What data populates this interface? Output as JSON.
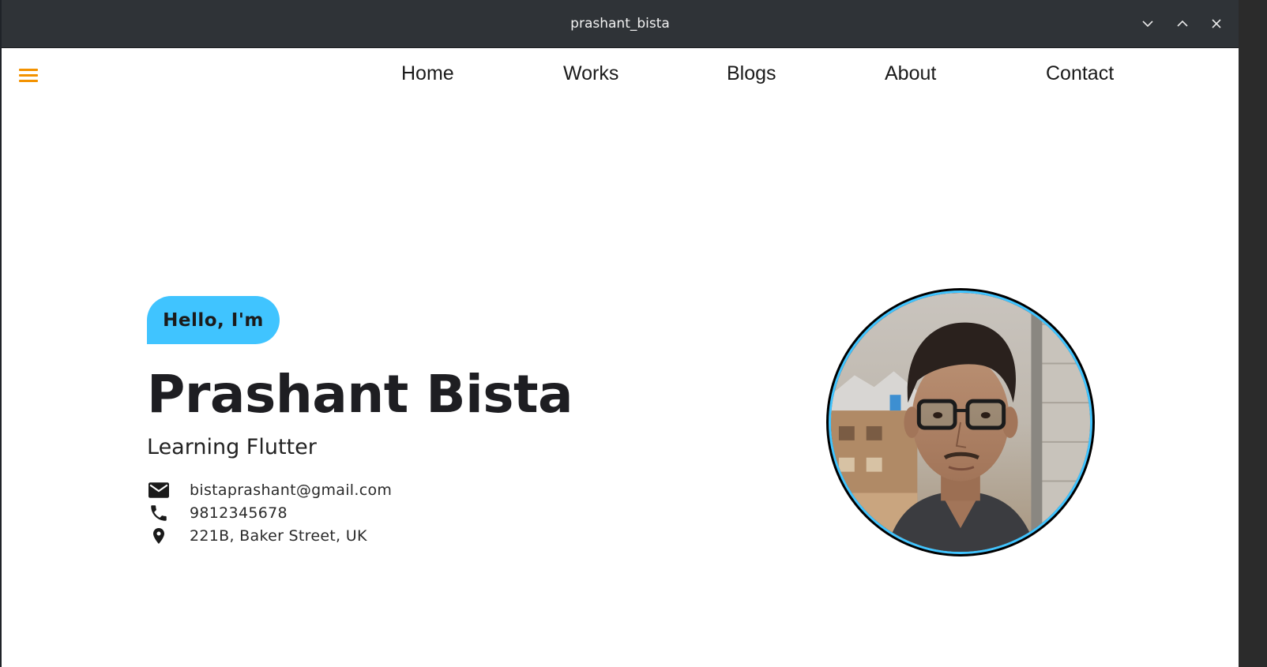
{
  "window": {
    "title": "prashant_bista",
    "controls": {
      "minimize_icon": "chevron-down-icon",
      "maximize_icon": "chevron-up-icon",
      "close_icon": "close-icon"
    }
  },
  "nav": {
    "menu_icon": "hamburger-menu-icon",
    "items": [
      "Home",
      "Works",
      "Blogs",
      "About",
      "Contact"
    ]
  },
  "hero": {
    "greeting": "Hello, I'm",
    "name": "Prashant Bista",
    "subtitle": "Learning Flutter",
    "contacts": [
      {
        "icon": "mail-icon",
        "text": "bistaprashant@gmail.com"
      },
      {
        "icon": "phone-icon",
        "text": "9812345678"
      },
      {
        "icon": "location-pin-icon",
        "text": "221B, Baker Street, UK"
      }
    ],
    "avatar_alt": "profile-photo"
  },
  "colors": {
    "titlebar": "#2f3337",
    "accent_orange": "#f39200",
    "accent_blue": "#40c4ff",
    "text_dark": "#1e1e22"
  }
}
